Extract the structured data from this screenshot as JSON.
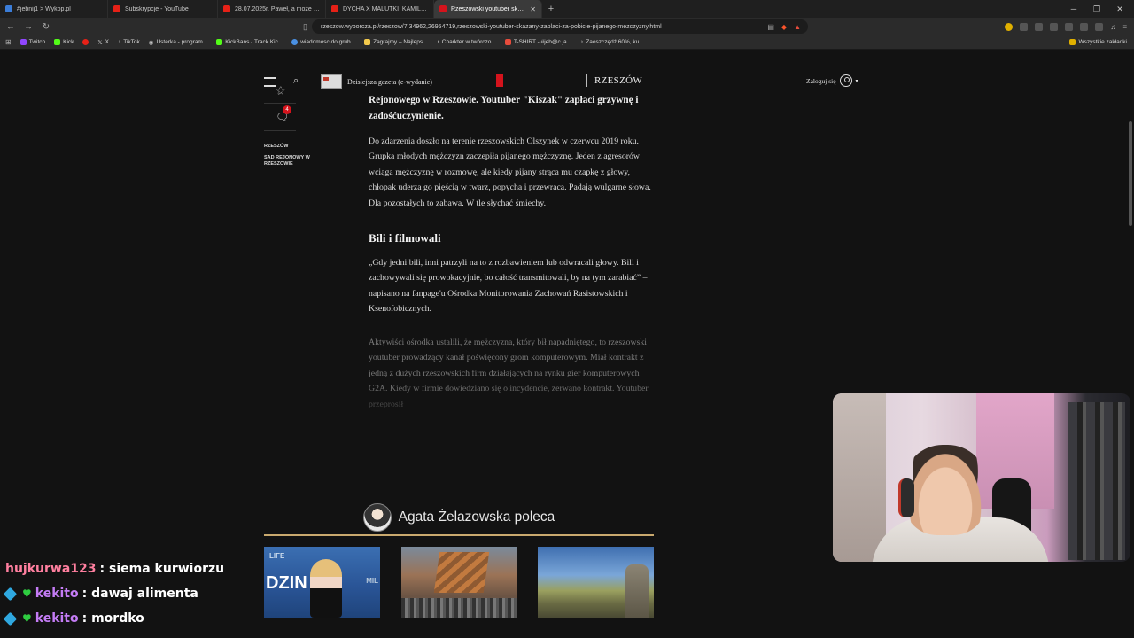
{
  "tabs": [
    {
      "label": "#jebnij1 > Wykop.pl",
      "color": "#3b7dd8",
      "active": false
    },
    {
      "label": "Subskrypcje - YouTube",
      "color": "#e62117",
      "active": false
    },
    {
      "label": "28.07.2025r. Paweł, a może Dariusz...",
      "color": "#e62117",
      "active": false
    },
    {
      "label": "DYCHA X MALUTKI_KAMILEK - KOBIETY",
      "color": "#e62117",
      "active": false
    },
    {
      "label": "Rzeszowski youtuber skazany. Za...",
      "color": "#d4131c",
      "active": true
    }
  ],
  "url": "rzeszow.wyborcza.pl/rzeszow/7,34962,26954719,rzeszowski-youtuber-skazany-zaplaci-za-pobicie-pijanego-mezczyzny.html",
  "bookmarks": [
    {
      "label": "Twitch",
      "color": "#9146ff"
    },
    {
      "label": "Kick",
      "color": "#53fc18"
    },
    {
      "label": "",
      "color": "#e62117"
    },
    {
      "label": "X",
      "color": "#ffffff"
    },
    {
      "label": "TikTok",
      "color": "#eeeeee"
    },
    {
      "label": "Usterka - program...",
      "color": "#ffffff"
    },
    {
      "label": "KickBans - Track Kic...",
      "color": "#53fc18"
    },
    {
      "label": "wiadomosc do grub...",
      "color": "#4a90e2"
    },
    {
      "label": "Zagrajmy – Najleps...",
      "color": "#f2c94c"
    },
    {
      "label": "Charkter w twórczo...",
      "color": "#eeeeee"
    },
    {
      "label": "T-SHIRT - #jeb@c ja...",
      "color": "#e74c3c"
    },
    {
      "label": "Zaoszczędź 60%, ku...",
      "color": "#eeeeee"
    }
  ],
  "bookmarks_all": "Wszystkie zakładki",
  "site": {
    "paper_label": "Dzisiejsza gazeta (e-wydanie)",
    "city": "RZESZÓW",
    "login": "Zaloguj się"
  },
  "rail": {
    "comment_count": "4",
    "tag1": "RZESZÓW",
    "tag2": "SĄD REJONOWY W RZESZOWIE"
  },
  "article": {
    "lead": "Rejonowego w Rzeszowie. Youtuber \"Kiszak\" zapłaci grzywnę i zadośćuczynienie.",
    "para1": "Do zdarzenia doszło na terenie rzeszowskich Olszynek w czerwcu 2019 roku. Grupka młodych mężczyzn zaczepiła pijanego mężczyznę. Jeden z agresorów wciąga mężczyznę w rozmowę, ale kiedy pijany strąca mu czapkę z głowy, chłopak uderza go pięścią w twarz, popycha i przewraca. Padają wulgarne słowa. Dla pozostałych to zabawa. W tle słychać śmiechy.",
    "heading": "Bili i filmowali",
    "quote": "„Gdy jedni bili, inni patrzyli na to z rozbawieniem lub odwracali głowy. Bili i zachowywali się prowokacyjnie, bo całość transmitowali, by na tym zarabiać” – napisano na fanpage'u Ośrodka Monitorowania Zachowań Rasistowskich i Ksenofobicznych.",
    "faded": "Aktywiści ośrodka ustalili, że mężczyzna, który bił napadniętego, to rzeszowski youtuber prowadzący kanał poświęcony grom komputerowym. Miał kontrakt z jedną z dużych rzeszowskich firm działających na rynku gier komputerowych G2A. Kiedy w firmie dowiedziano się o incydencie, zerwano kontrakt. Youtuber przeprosił"
  },
  "recommend": {
    "title": "Agata Żelazowska poleca",
    "card1_text1": "LIFE",
    "card1_text2": "DZIN",
    "card1_text3": "MIL"
  },
  "chat": [
    {
      "user": "hujkurwa123",
      "user_color": "#ff7f9f",
      "message": ": siema kurwiorzu",
      "badges": false
    },
    {
      "user": "kekito",
      "user_color": "#c47cf5",
      "message": ": dawaj alimenta",
      "badges": true
    },
    {
      "user": "kekito",
      "user_color": "#c47cf5",
      "message": ": mordko",
      "badges": true
    }
  ]
}
